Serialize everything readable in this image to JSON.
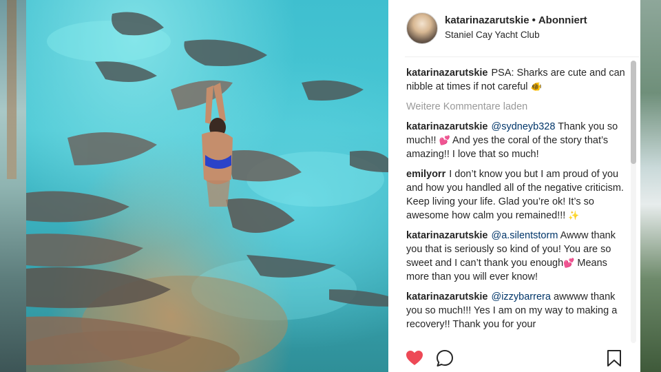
{
  "post": {
    "username": "katarinazarutskie",
    "separator": "•",
    "follow_status": "Abonniert",
    "location": "Staniel Cay Yacht Club"
  },
  "caption": {
    "user": "katarinazarutskie",
    "text": "PSA: Sharks are cute and can nibble at times if not careful",
    "emoji": "🐠"
  },
  "load_more_label": "Weitere Kommentare laden",
  "comments": [
    {
      "user": "katarinazarutskie",
      "mention": "@sydneyb328",
      "text_before_emoji": "Thank you so much!!",
      "emoji": "💕",
      "text_after_emoji": "And yes the coral of the story that’s amazing!! I love that so much!"
    },
    {
      "user": "emilyorr",
      "text": "I don’t know you but I am proud of you and how you handled all of the negative criticism. Keep living your life. Glad you’re ok! It’s so awesome how calm you remained!!!",
      "emoji": "✨"
    },
    {
      "user": "katarinazarutskie",
      "mention": "@a.silentstorm",
      "text_before_emoji": "Awww thank you that is seriously so kind of you! You are so sweet and I can’t thank you enough",
      "emoji": "💕",
      "text_after_emoji": "Means more than you will ever know!"
    },
    {
      "user": "katarinazarutskie",
      "mention": "@izzybarrera",
      "text": "awwww thank you so much!!! Yes I am on my way to making a recovery!! Thank you for your"
    }
  ],
  "icons": {
    "like": "heart-icon",
    "comment": "comment-bubble-icon",
    "save": "bookmark-icon"
  },
  "colors": {
    "like_red": "#ed4956",
    "text": "#262626",
    "muted": "#999999",
    "mention": "#003569"
  }
}
